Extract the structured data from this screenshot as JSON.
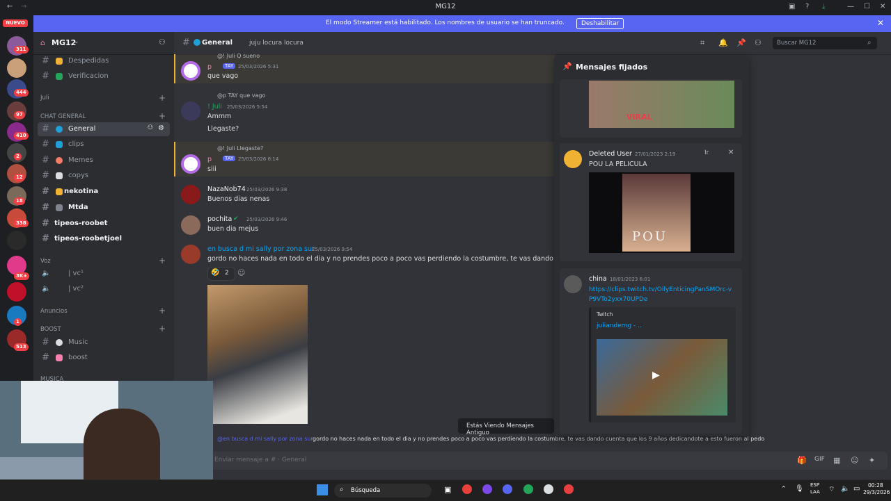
{
  "window": {
    "title": "MG12"
  },
  "banner": {
    "message": "El modo Streamer está habilitado. Los nombres de usuario se han truncado.",
    "button": "Deshabilitar"
  },
  "rail": {
    "new_label": "NUEVO",
    "badges": [
      "311",
      "444",
      "97",
      "410",
      "2",
      "12",
      "18",
      "338",
      "3K+",
      "1",
      "513"
    ]
  },
  "server": {
    "name": "MG12"
  },
  "sidebar": {
    "channels_top": [
      {
        "name": "Despedidas"
      },
      {
        "name": "Verificacion"
      }
    ],
    "cat_juli": "Juli",
    "cat_chat": "CHAT GENERAL",
    "chat_channels": [
      {
        "name": "General"
      },
      {
        "name": "clips"
      },
      {
        "name": "Memes"
      },
      {
        "name": "copys"
      },
      {
        "name": "nekotina"
      },
      {
        "name": "Mtda"
      },
      {
        "name": "tipeos-roobet"
      },
      {
        "name": "tipeos-roobetjoel"
      }
    ],
    "cat_voz": "Voz",
    "voice": [
      {
        "name": "| vc¹"
      },
      {
        "name": "| vc²"
      }
    ],
    "cat_anuncios": "Anuncios",
    "cat_boost": "BOOST",
    "boost_channels": [
      {
        "name": "Music"
      },
      {
        "name": "boost"
      }
    ],
    "cat_musica": "MUSICA"
  },
  "header": {
    "channel": "General",
    "topic": "juju locura locura",
    "search_placeholder": "Buscar MG12"
  },
  "messages": [
    {
      "reply": "@! Juli Q sueno",
      "author": "p",
      "tag": "TAY",
      "time": "25/03/2026 5:31",
      "text": "que vago"
    },
    {
      "reply": "@p TAY que vago",
      "author": "! Juli",
      "time": "25/03/2026 5:54",
      "lines": [
        "Ammm",
        "Llegaste?"
      ]
    },
    {
      "reply": "@! Juli Llegaste?",
      "author": "p",
      "tag": "TAY",
      "time": "25/03/2026 6:14",
      "text": "siii"
    },
    {
      "author": "NazaNob74",
      "time": "25/03/2026 9:38",
      "text": "Buenos dias nenas"
    },
    {
      "author": "pochita",
      "time": "25/03/2026 9:46",
      "text": "buen dia mejus"
    },
    {
      "author": "en busca d mi sally por zona sur",
      "time": "25/03/2026 9:54",
      "text": "gordo no haces nada en todo el dia y no prendes poco a poco vas perdiendo la costumbre, te vas dando cuenta",
      "reaction_count": "2"
    }
  ],
  "bottom_reply": {
    "author": "@en busca d mi sally por zona sur",
    "text": "gordo no haces nada en todo el dia y no prendes poco a poco vas perdiendo la costumbre, te vas dando cuenta que los 9 años dedicandote a esto fueron al pedo"
  },
  "notice": "Estás Viendo Mensajes Antiguo",
  "pinned": {
    "title": "Mensajes fijados",
    "items": [
      {
        "author": "Deleted User",
        "time": "27/01/2023 2:19",
        "text": "POU LA PELICULA",
        "jump": "Ir",
        "video_caption": "POU"
      },
      {
        "author": "china",
        "time": "18/01/2023 6:01",
        "link": "https://clips.twitch.tv/OilyEnticingPanSMOrc-vP9VTo2yxx70UPDe",
        "embed_provider": "Twitch",
        "embed_title": "juliandemg - .."
      }
    ],
    "first_image_caption": "VIRAL"
  },
  "composer": {
    "placeholder": "Enviar mensaje a #  · General"
  },
  "taskbar": {
    "search": "Búsqueda",
    "lang": "ESP",
    "lang2": "LAA",
    "time": "00:28",
    "date": "29/3/2026"
  },
  "colors": {
    "accent": "#5865f2",
    "bg": "#313338",
    "sidebar": "#2b2d31",
    "rail": "#1e1f22",
    "link": "#00a8fc"
  }
}
